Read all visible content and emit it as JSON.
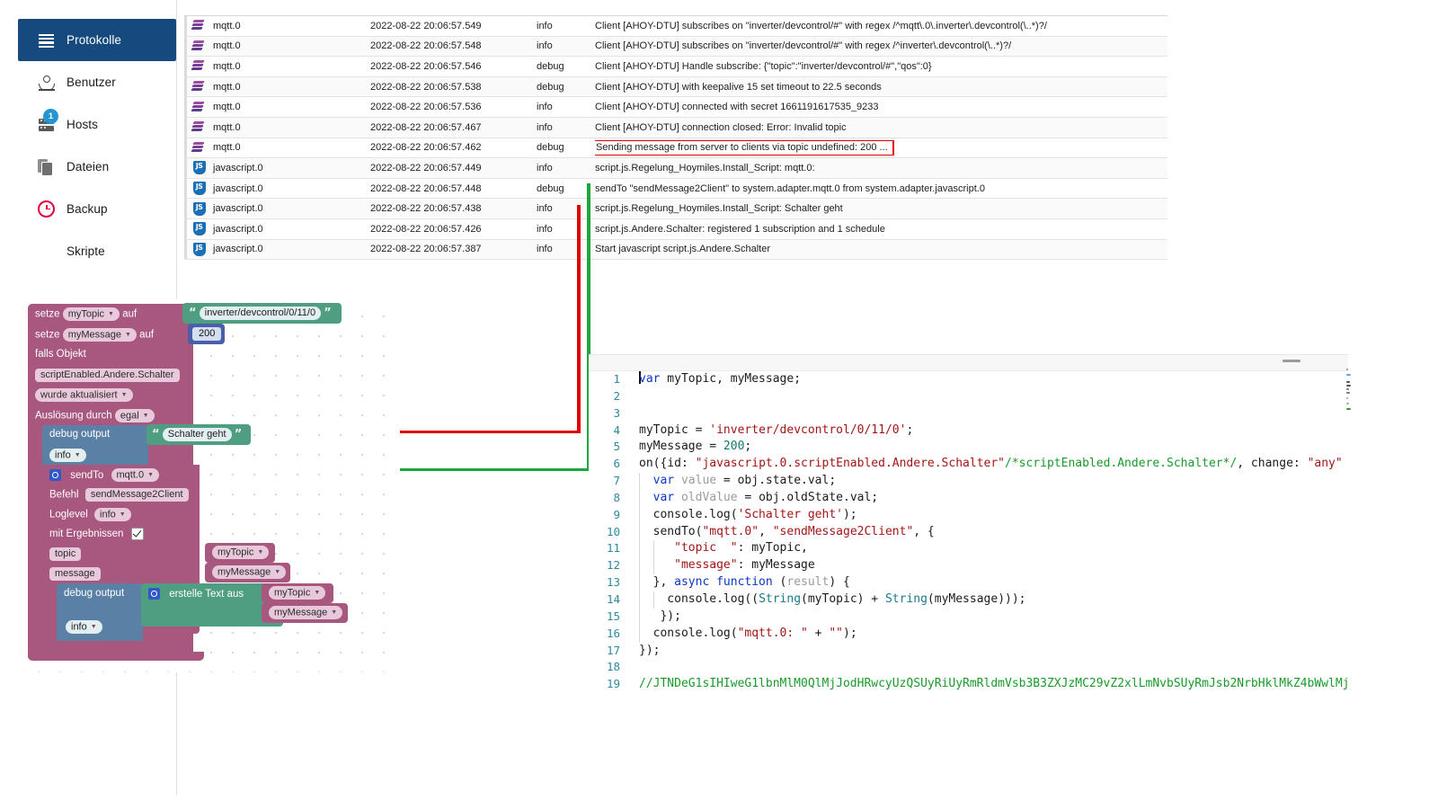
{
  "sidebar": {
    "items": [
      {
        "label": "Protokolle",
        "icon": "list-icon",
        "active": true,
        "badge": null
      },
      {
        "label": "Benutzer",
        "icon": "person-icon",
        "active": false,
        "badge": null
      },
      {
        "label": "Hosts",
        "icon": "server-icon",
        "active": false,
        "badge": "1"
      },
      {
        "label": "Dateien",
        "icon": "files-icon",
        "active": false,
        "badge": null
      },
      {
        "label": "Backup",
        "icon": "clock-icon",
        "active": false,
        "badge": null
      },
      {
        "label": "Skripte",
        "icon": "js-icon",
        "active": false,
        "badge": null
      }
    ]
  },
  "log": {
    "rows": [
      {
        "icon": "mqtt-icon",
        "source": "mqtt.0",
        "timestamp": "2022-08-22 20:06:57.549",
        "severity": "info",
        "message": "Client [AHOY-DTU] subscribes on \"inverter/devcontrol/#\"  with regex /^mqtt\\.0\\.inverter\\.devcontrol(\\..*)?/",
        "highlight": false
      },
      {
        "icon": "mqtt-icon",
        "source": "mqtt.0",
        "timestamp": "2022-08-22 20:06:57.548",
        "severity": "info",
        "message": "Client [AHOY-DTU] subscribes on \"inverter/devcontrol/#\"  with regex /^inverter\\.devcontrol(\\..*)?/",
        "highlight": false
      },
      {
        "icon": "mqtt-icon",
        "source": "mqtt.0",
        "timestamp": "2022-08-22 20:06:57.546",
        "severity": "debug",
        "message": "Client [AHOY-DTU] Handle subscribe: {\"topic\":\"inverter/devcontrol/#\",\"qos\":0}",
        "highlight": false
      },
      {
        "icon": "mqtt-icon",
        "source": "mqtt.0",
        "timestamp": "2022-08-22 20:06:57.538",
        "severity": "debug",
        "message": "Client [AHOY-DTU] with keepalive 15 set timeout to 22.5 seconds",
        "highlight": false
      },
      {
        "icon": "mqtt-icon",
        "source": "mqtt.0",
        "timestamp": "2022-08-22 20:06:57.536",
        "severity": "info",
        "message": "Client [AHOY-DTU] connected with secret 1661191617535_9233",
        "highlight": false
      },
      {
        "icon": "mqtt-icon",
        "source": "mqtt.0",
        "timestamp": "2022-08-22 20:06:57.467",
        "severity": "info",
        "message": "Client [AHOY-DTU] connection closed: Error: Invalid topic",
        "highlight": false
      },
      {
        "icon": "mqtt-icon",
        "source": "mqtt.0",
        "timestamp": "2022-08-22 20:06:57.462",
        "severity": "debug",
        "message": "Sending message from server to clients via topic undefined: 200 ...",
        "highlight": true
      },
      {
        "icon": "js-icon",
        "source": "javascript.0",
        "timestamp": "2022-08-22 20:06:57.449",
        "severity": "info",
        "message": "script.js.Regelung_Hoymiles.Install_Script: mqtt.0:",
        "highlight": false
      },
      {
        "icon": "js-icon",
        "source": "javascript.0",
        "timestamp": "2022-08-22 20:06:57.448",
        "severity": "debug",
        "message": "sendTo \"sendMessage2Client\" to system.adapter.mqtt.0 from system.adapter.javascript.0",
        "highlight": false
      },
      {
        "icon": "js-icon",
        "source": "javascript.0",
        "timestamp": "2022-08-22 20:06:57.438",
        "severity": "info",
        "message": "script.js.Regelung_Hoymiles.Install_Script: Schalter geht",
        "highlight": false
      },
      {
        "icon": "js-icon",
        "source": "javascript.0",
        "timestamp": "2022-08-22 20:06:57.426",
        "severity": "info",
        "message": "script.js.Andere.Schalter: registered 1 subscription and 1 schedule",
        "highlight": false
      },
      {
        "icon": "js-icon",
        "source": "javascript.0",
        "timestamp": "2022-08-22 20:06:57.387",
        "severity": "info",
        "message": "Start javascript script.js.Andere.Schalter",
        "highlight": false
      }
    ]
  },
  "blockly": {
    "set1": {
      "verb": "setze",
      "variable": "myTopic",
      "to": "auf",
      "value": "inverter/devcontrol/0/11/0"
    },
    "set2": {
      "verb": "setze",
      "variable": "myMessage",
      "to": "auf",
      "value": "200"
    },
    "trigger": {
      "if_label": "falls Objekt",
      "object_id": "scriptEnabled.Andere.Schalter",
      "condition": "wurde aktualisiert",
      "source_label": "Auslösung durch",
      "source_value": "egal"
    },
    "debug1": {
      "label": "debug output",
      "text": "Schalter geht",
      "level": "info"
    },
    "sendto": {
      "label": "sendTo",
      "instance": "mqtt.0",
      "command_label": "Befehl",
      "command": "sendMessage2Client",
      "loglevel_label": "Loglevel",
      "loglevel": "info",
      "results_label": "mit Ergebnissen",
      "arg1_label": "topic",
      "arg1_value": "myTopic",
      "arg2_label": "message",
      "arg2_value": "myMessage"
    },
    "debug2": {
      "label": "debug output",
      "text_builder": "erstelle Text aus",
      "item1": "myTopic",
      "item2": "myMessage",
      "level": "info"
    }
  },
  "editor": {
    "lines": [
      {
        "n": "1",
        "segments": [
          {
            "t": "caret"
          },
          {
            "t": "kw",
            "v": "var"
          },
          {
            "t": "plain",
            "v": " myTopic, myMessage;"
          }
        ],
        "indent": 0
      },
      {
        "n": "2",
        "segments": [],
        "indent": 0
      },
      {
        "n": "3",
        "segments": [],
        "indent": 0
      },
      {
        "n": "4",
        "segments": [
          {
            "t": "plain",
            "v": "myTopic = "
          },
          {
            "t": "str",
            "v": "'inverter/devcontrol/0/11/0'"
          },
          {
            "t": "plain",
            "v": ";"
          }
        ],
        "indent": 0
      },
      {
        "n": "5",
        "segments": [
          {
            "t": "plain",
            "v": "myMessage = "
          },
          {
            "t": "num",
            "v": "200"
          },
          {
            "t": "plain",
            "v": ";"
          }
        ],
        "indent": 0
      },
      {
        "n": "6",
        "segments": [
          {
            "t": "plain",
            "v": "on({id: "
          },
          {
            "t": "str",
            "v": "\"javascript.0.scriptEnabled.Andere.Schalter\""
          },
          {
            "t": "cmt",
            "v": "/*scriptEnabled.Andere.Schalter*/"
          },
          {
            "t": "plain",
            "v": ", change: "
          },
          {
            "t": "str",
            "v": "\"any\""
          }
        ],
        "indent": 0
      },
      {
        "n": "7",
        "segments": [
          {
            "t": "plain",
            "v": "  "
          },
          {
            "t": "kw",
            "v": "var"
          },
          {
            "t": "dim",
            "v": " value"
          },
          {
            "t": "plain",
            "v": " = obj.state.val;"
          }
        ],
        "indent": 1
      },
      {
        "n": "8",
        "segments": [
          {
            "t": "plain",
            "v": "  "
          },
          {
            "t": "kw",
            "v": "var"
          },
          {
            "t": "dim",
            "v": " oldValue"
          },
          {
            "t": "plain",
            "v": " = obj.oldState.val;"
          }
        ],
        "indent": 1
      },
      {
        "n": "9",
        "segments": [
          {
            "t": "plain",
            "v": "  console.log("
          },
          {
            "t": "str",
            "v": "'Schalter geht'"
          },
          {
            "t": "plain",
            "v": ");"
          }
        ],
        "indent": 1
      },
      {
        "n": "10",
        "segments": [
          {
            "t": "plain",
            "v": "  sendTo("
          },
          {
            "t": "str",
            "v": "\"mqtt.0\""
          },
          {
            "t": "plain",
            "v": ", "
          },
          {
            "t": "str",
            "v": "\"sendMessage2Client\""
          },
          {
            "t": "plain",
            "v": ", {"
          }
        ],
        "indent": 1
      },
      {
        "n": "11",
        "segments": [
          {
            "t": "plain",
            "v": "     "
          },
          {
            "t": "str",
            "v": "\"topic  \""
          },
          {
            "t": "plain",
            "v": ": myTopic,"
          }
        ],
        "indent": 2
      },
      {
        "n": "12",
        "segments": [
          {
            "t": "plain",
            "v": "     "
          },
          {
            "t": "str",
            "v": "\"message\""
          },
          {
            "t": "plain",
            "v": ": myMessage"
          }
        ],
        "indent": 2
      },
      {
        "n": "13",
        "segments": [
          {
            "t": "plain",
            "v": "  }, "
          },
          {
            "t": "kw",
            "v": "async function"
          },
          {
            "t": "plain",
            "v": " ("
          },
          {
            "t": "dim",
            "v": "result"
          },
          {
            "t": "plain",
            "v": ") {"
          }
        ],
        "indent": 1
      },
      {
        "n": "14",
        "segments": [
          {
            "t": "plain",
            "v": "    console.log(("
          },
          {
            "t": "fn",
            "v": "String"
          },
          {
            "t": "plain",
            "v": "(myTopic) + "
          },
          {
            "t": "fn",
            "v": "String"
          },
          {
            "t": "plain",
            "v": "(myMessage)));"
          }
        ],
        "indent": 2
      },
      {
        "n": "15",
        "segments": [
          {
            "t": "plain",
            "v": "   });"
          }
        ],
        "indent": 1
      },
      {
        "n": "16",
        "segments": [
          {
            "t": "plain",
            "v": "  console.log("
          },
          {
            "t": "str",
            "v": "\"mqtt.0: \""
          },
          {
            "t": "plain",
            "v": " + "
          },
          {
            "t": "str",
            "v": "\"\""
          },
          {
            "t": "plain",
            "v": ");"
          }
        ],
        "indent": 1
      },
      {
        "n": "17",
        "segments": [
          {
            "t": "plain",
            "v": "});"
          }
        ],
        "indent": 0
      },
      {
        "n": "18",
        "segments": [],
        "indent": 0
      },
      {
        "n": "19",
        "segments": [
          {
            "t": "cmt",
            "v": "//JTNDeG1sIHIweG1lbnMlM0QlMjJodHRwcyUzQSUyRiUyRmRldmVsb3B3ZXJzMC29vZ2xlLmNvbSUyRmJsb2NrbHklMkZ4bWwlMj"
          }
        ],
        "indent": 0
      }
    ]
  },
  "annotations": {
    "red_color": "#e00000",
    "green_color": "#1aa73c"
  }
}
